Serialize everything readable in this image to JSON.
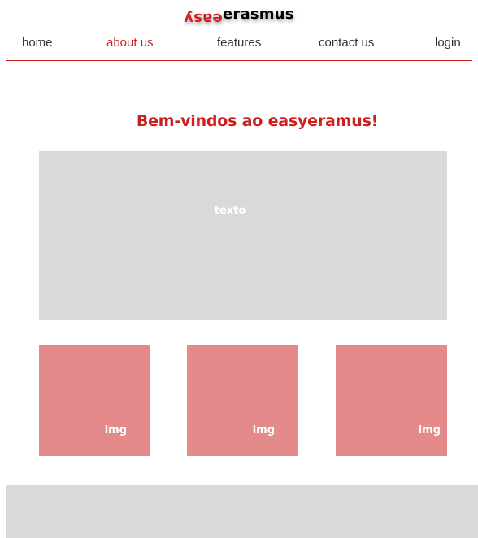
{
  "logo": {
    "part1": "easy",
    "part2": "erasmus"
  },
  "nav": {
    "items": [
      {
        "label": "home"
      },
      {
        "label": "about us"
      },
      {
        "label": "features"
      },
      {
        "label": "contact us"
      },
      {
        "label": "login"
      }
    ],
    "active": "about us"
  },
  "main": {
    "welcome": "Bem-vindos ao easyeramus!",
    "text_placeholder": "texto",
    "images": [
      {
        "label": "img"
      },
      {
        "label": "img"
      },
      {
        "label": "img"
      }
    ]
  },
  "colors": {
    "accent": "#cc1f1f",
    "image_placeholder": "#e48a8a",
    "block_placeholder": "#d9d9d9"
  }
}
